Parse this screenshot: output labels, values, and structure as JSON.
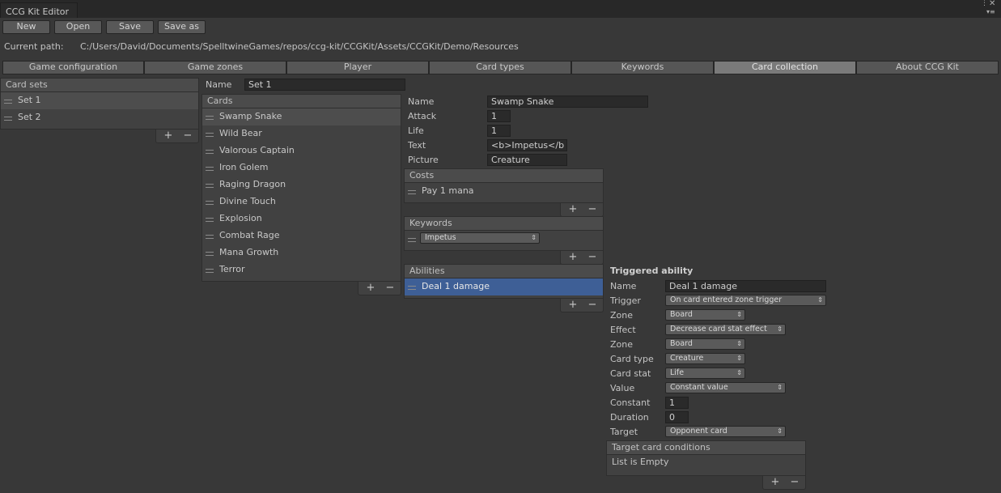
{
  "window": {
    "title": "CCG Kit Editor",
    "menu_icon": "kebab-menu-icon",
    "close_icon": "close-icon"
  },
  "toolbar": {
    "new": "New",
    "open": "Open",
    "save": "Save",
    "save_as": "Save as"
  },
  "path": {
    "label": "Current path:",
    "value": "C:/Users/David/Documents/SpelltwineGames/repos/ccg-kit/CCGKit/Assets/CCGKit/Demo/Resources"
  },
  "tabs": [
    "Game configuration",
    "Game zones",
    "Player",
    "Card types",
    "Keywords",
    "Card collection",
    "About CCG Kit"
  ],
  "active_tab": "Card collection",
  "card_sets": {
    "header": "Card sets",
    "items": [
      "Set 1",
      "Set 2"
    ]
  },
  "set_name": {
    "label": "Name",
    "value": "Set 1"
  },
  "cards": {
    "header": "Cards",
    "items": [
      "Swamp Snake",
      "Wild Bear",
      "Valorous Captain",
      "Iron Golem",
      "Raging Dragon",
      "Divine Touch",
      "Explosion",
      "Combat Rage",
      "Mana Growth",
      "Terror"
    ]
  },
  "card": {
    "name_label": "Name",
    "name": "Swamp Snake",
    "attack_label": "Attack",
    "attack": "1",
    "life_label": "Life",
    "life": "1",
    "text_label": "Text",
    "text": "<b>Impetus</b",
    "picture_label": "Picture",
    "picture": "Creature"
  },
  "costs": {
    "header": "Costs",
    "items": [
      "Pay 1 mana"
    ]
  },
  "keywords": {
    "header": "Keywords",
    "items": [
      "Impetus"
    ]
  },
  "abilities": {
    "header": "Abilities",
    "items": [
      "Deal 1 damage"
    ]
  },
  "triggered": {
    "title": "Triggered ability",
    "name_label": "Name",
    "name": "Deal 1 damage",
    "trigger_label": "Trigger",
    "trigger": "On card entered zone trigger",
    "zone_label": "Zone",
    "zone": "Board",
    "effect_label": "Effect",
    "effect": "Decrease card stat effect",
    "zone2_label": "Zone",
    "zone2": "Board",
    "card_type_label": "Card type",
    "card_type": "Creature",
    "card_stat_label": "Card stat",
    "card_stat": "Life",
    "value_label": "Value",
    "value": "Constant value",
    "constant_label": "Constant",
    "constant": "1",
    "duration_label": "Duration",
    "duration": "0",
    "target_label": "Target",
    "target": "Opponent card"
  },
  "target_conditions": {
    "header": "Target card conditions",
    "empty": "List is Empty"
  },
  "list_controls": {
    "plus": "+",
    "minus": "−"
  },
  "colors": {
    "background": "#383838",
    "selected": "#3e5f96",
    "active_tab": "#7a7a7a"
  }
}
